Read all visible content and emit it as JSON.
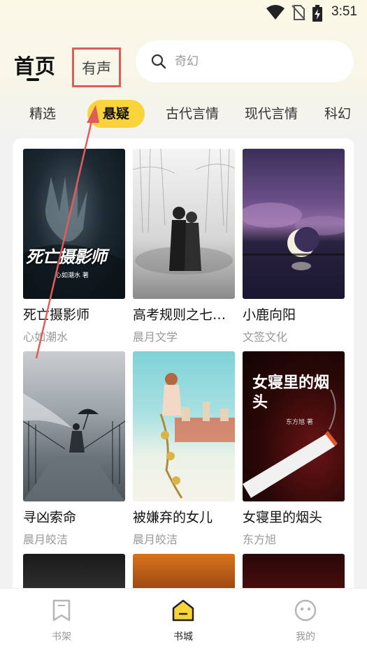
{
  "status_bar": {
    "time": "3:51"
  },
  "header": {
    "title": "首页",
    "audio_tab": "有声",
    "search_placeholder": "奇幻"
  },
  "categories": [
    {
      "label": "精选"
    },
    {
      "label": "悬疑"
    },
    {
      "label": "古代言情"
    },
    {
      "label": "现代言情"
    },
    {
      "label": "科幻"
    }
  ],
  "active_category": "悬疑",
  "books": [
    {
      "title": "死亡摄影师",
      "author": "心如潮水",
      "cover_text": "死亡摄影师",
      "cover_subtext": "心如潮水 著"
    },
    {
      "title": "高考规则之七宗罪",
      "author": "晨月文学"
    },
    {
      "title": "小鹿向阳",
      "author": "文签文化"
    },
    {
      "title": "寻凶索命",
      "author": "晨月皎洁"
    },
    {
      "title": "被嫌弃的女儿",
      "author": "晨月皎洁"
    },
    {
      "title": "女寝里的烟头",
      "author": "东方旭",
      "cover_text": "女寝里的烟头",
      "cover_subtext": "东方旭 著"
    }
  ],
  "bottom_nav": [
    {
      "label": "书架",
      "icon": "bookmark-icon"
    },
    {
      "label": "书城",
      "icon": "home-icon"
    },
    {
      "label": "我的",
      "icon": "profile-face-icon"
    }
  ],
  "colors": {
    "accent_yellow": "#f8d43a",
    "annotation_red": "#e25b5b"
  }
}
